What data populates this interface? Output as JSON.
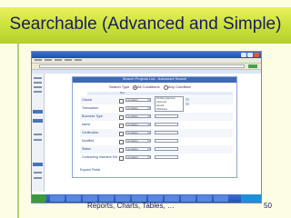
{
  "slide": {
    "title": "Searchable (Advanced and Simple)",
    "footer": "Reports, Charts, Tables, …",
    "page_number": "50"
  },
  "screenshot": {
    "window_title": "",
    "address_text": "",
    "dialog_title": "Search Projects List - Advanced Search",
    "search_type_label": "Search Type",
    "search_options": [
      "All Conditions",
      "Any Condition"
    ],
    "column_header": "Not",
    "rows": [
      {
        "label": "Classic",
        "operator": "Contains"
      },
      {
        "label": "Transaction",
        "operator": "Contains"
      },
      {
        "label": "Business Type",
        "operator": "Contains"
      },
      {
        "label": "Name",
        "operator": "Contains"
      },
      {
        "label": "Certification",
        "operator": "Contains"
      },
      {
        "label": "Modified",
        "operator": "Contains"
      },
      {
        "label": "Status",
        "operator": "Contains"
      },
      {
        "label": "Contracting Incentive Ent",
        "operator": "Contains"
      }
    ],
    "list_options": [
      "Pending Approval",
      "Approved",
      "Denied",
      "Withdrawn"
    ],
    "footer_link": "Expand Fields"
  },
  "colors": {
    "title_band": "#c9e03a",
    "title_text": "#1a1a60",
    "background": "#fdfde6",
    "taskbar": "#2452b0"
  }
}
